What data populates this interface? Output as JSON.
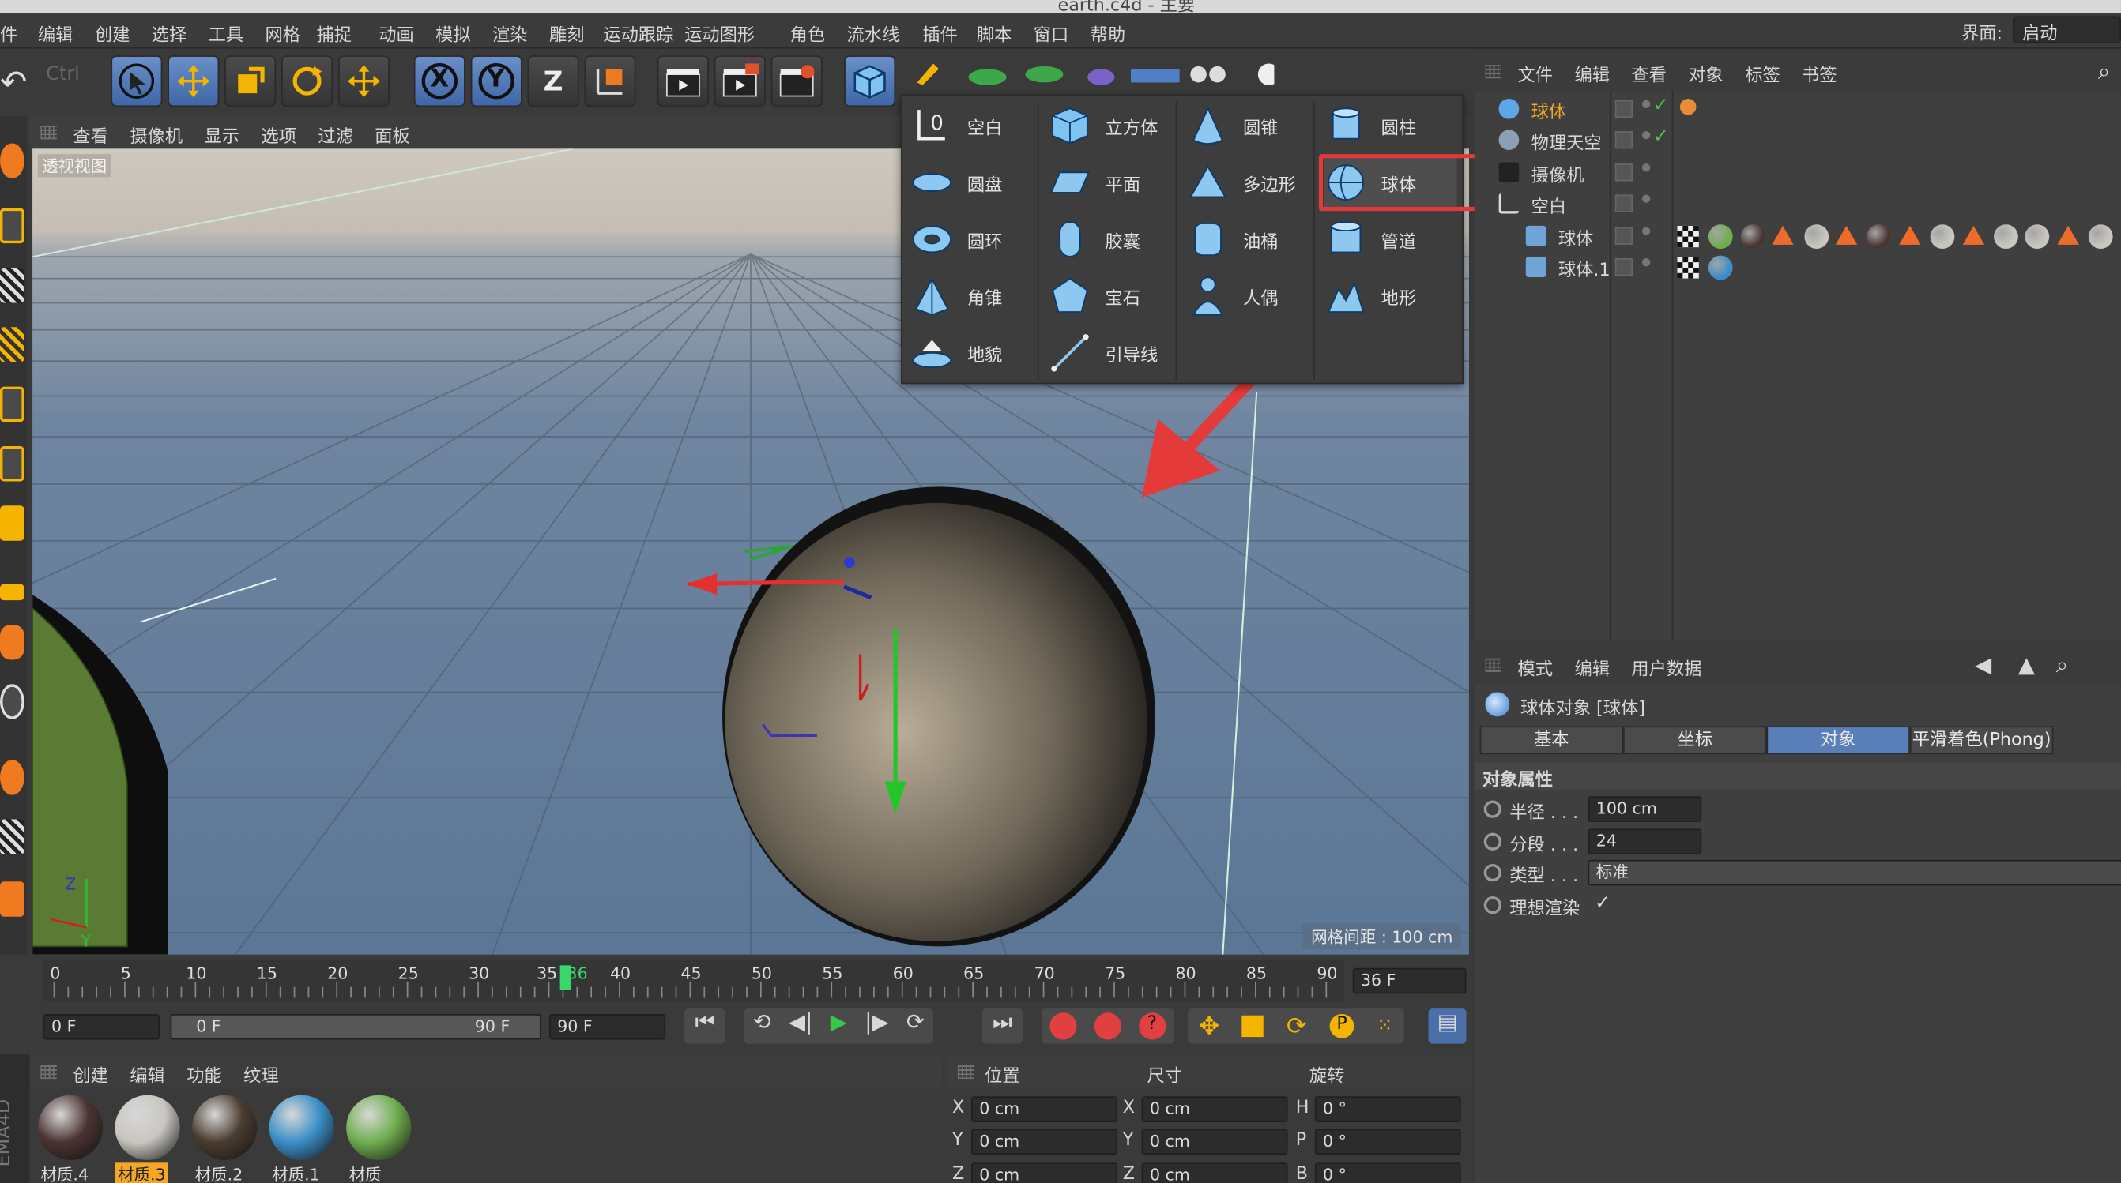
{
  "window_title": "earth.c4d - 主要",
  "menu": [
    "件",
    "编辑",
    "创建",
    "选择",
    "工具",
    "网格",
    "捕捉",
    "动画",
    "模拟",
    "渲染",
    "雕刻",
    "运动跟踪",
    "运动图形",
    "角色",
    "流水线",
    "插件",
    "脚本",
    "窗口",
    "帮助"
  ],
  "layout_label": "界面:",
  "layout_value": "启动",
  "toolbar": {
    "axis_x": "X",
    "axis_y": "Y",
    "axis_z": "Z"
  },
  "viewport": {
    "menu": [
      "查看",
      "摄像机",
      "显示",
      "选项",
      "过滤",
      "面板"
    ],
    "view_name": "透视视图",
    "grid_spacing": "网格间距 : 100 cm"
  },
  "create_menu": {
    "items": [
      {
        "label": "空白",
        "icon": "null-object-icon"
      },
      {
        "label": "立方体",
        "icon": "cube-icon"
      },
      {
        "label": "圆锥",
        "icon": "cone-icon"
      },
      {
        "label": "圆柱",
        "icon": "cylinder-icon"
      },
      {
        "label": "圆盘",
        "icon": "disc-icon"
      },
      {
        "label": "平面",
        "icon": "plane-icon"
      },
      {
        "label": "多边形",
        "icon": "polygon-icon"
      },
      {
        "label": "球体",
        "icon": "sphere-icon"
      },
      {
        "label": "圆环",
        "icon": "torus-icon"
      },
      {
        "label": "胶囊",
        "icon": "capsule-icon"
      },
      {
        "label": "油桶",
        "icon": "oil-tank-icon"
      },
      {
        "label": "管道",
        "icon": "tube-icon"
      },
      {
        "label": "角锥",
        "icon": "pyramid-icon"
      },
      {
        "label": "宝石",
        "icon": "platonic-icon"
      },
      {
        "label": "人偶",
        "icon": "figure-icon"
      },
      {
        "label": "地形",
        "icon": "landscape-icon"
      },
      {
        "label": "地貌",
        "icon": "relief-icon"
      },
      {
        "label": "引导线",
        "icon": "guide-icon"
      }
    ],
    "highlighted": "球体",
    "highlight_color": "#e03a3a"
  },
  "object_manager": {
    "menu": [
      "文件",
      "编辑",
      "查看",
      "对象",
      "标签",
      "书签"
    ],
    "objects": [
      {
        "name": "球体",
        "selected": true,
        "indent": 0
      },
      {
        "name": "物理天空",
        "selected": false,
        "indent": 0
      },
      {
        "name": "摄像机",
        "selected": false,
        "indent": 0
      },
      {
        "name": "空白",
        "selected": false,
        "indent": 0
      },
      {
        "name": "球体",
        "selected": false,
        "indent": 1
      },
      {
        "name": "球体.1",
        "selected": false,
        "indent": 1
      }
    ]
  },
  "attributes": {
    "menu": [
      "模式",
      "编辑",
      "用户数据"
    ],
    "title": "球体对象 [球体]",
    "tabs": [
      "基本",
      "坐标",
      "对象",
      "平滑着色(Phong)"
    ],
    "active_tab": "对象",
    "section": "对象属性",
    "props": [
      {
        "label": "半径 . . .",
        "value": "100 cm"
      },
      {
        "label": "分段 . . .",
        "value": "24"
      },
      {
        "label": "类型 . . .",
        "value": "标准"
      },
      {
        "label": "理想渲染",
        "value": "✓"
      }
    ]
  },
  "timeline": {
    "ticks": [
      "0",
      "5",
      "10",
      "15",
      "20",
      "25",
      "30",
      "35",
      "36",
      "40",
      "45",
      "50",
      "55",
      "60",
      "65",
      "70",
      "75",
      "80",
      "85",
      "90"
    ],
    "current": "36 F",
    "start": "0 F",
    "range_start": "0 F",
    "range_end": "90 F",
    "end": "90 F"
  },
  "materials": {
    "menu": [
      "创建",
      "编辑",
      "功能",
      "纹理"
    ],
    "items": [
      {
        "name": "材质.4",
        "color": "#4a3432",
        "selected": false
      },
      {
        "name": "材质.3",
        "color": "#c9c6c0",
        "selected": true
      },
      {
        "name": "材质.2",
        "color": "#4b3c30",
        "selected": false
      },
      {
        "name": "材质.1",
        "color": "#3b8fc9",
        "selected": false
      },
      {
        "name": "材质",
        "color": "#6fae4e",
        "selected": false
      }
    ],
    "brand": "EMA4D"
  },
  "coords": {
    "headers": [
      "位置",
      "尺寸",
      "旋转"
    ],
    "rows": [
      {
        "a": "X",
        "av": "0 cm",
        "b": "X",
        "bv": "0 cm",
        "c": "H",
        "cv": "0 °"
      },
      {
        "a": "Y",
        "av": "0 cm",
        "b": "Y",
        "bv": "0 cm",
        "c": "P",
        "cv": "0 °"
      },
      {
        "a": "Z",
        "av": "0 cm",
        "b": "Z",
        "bv": "0 cm",
        "c": "B",
        "cv": "0 °"
      }
    ]
  }
}
